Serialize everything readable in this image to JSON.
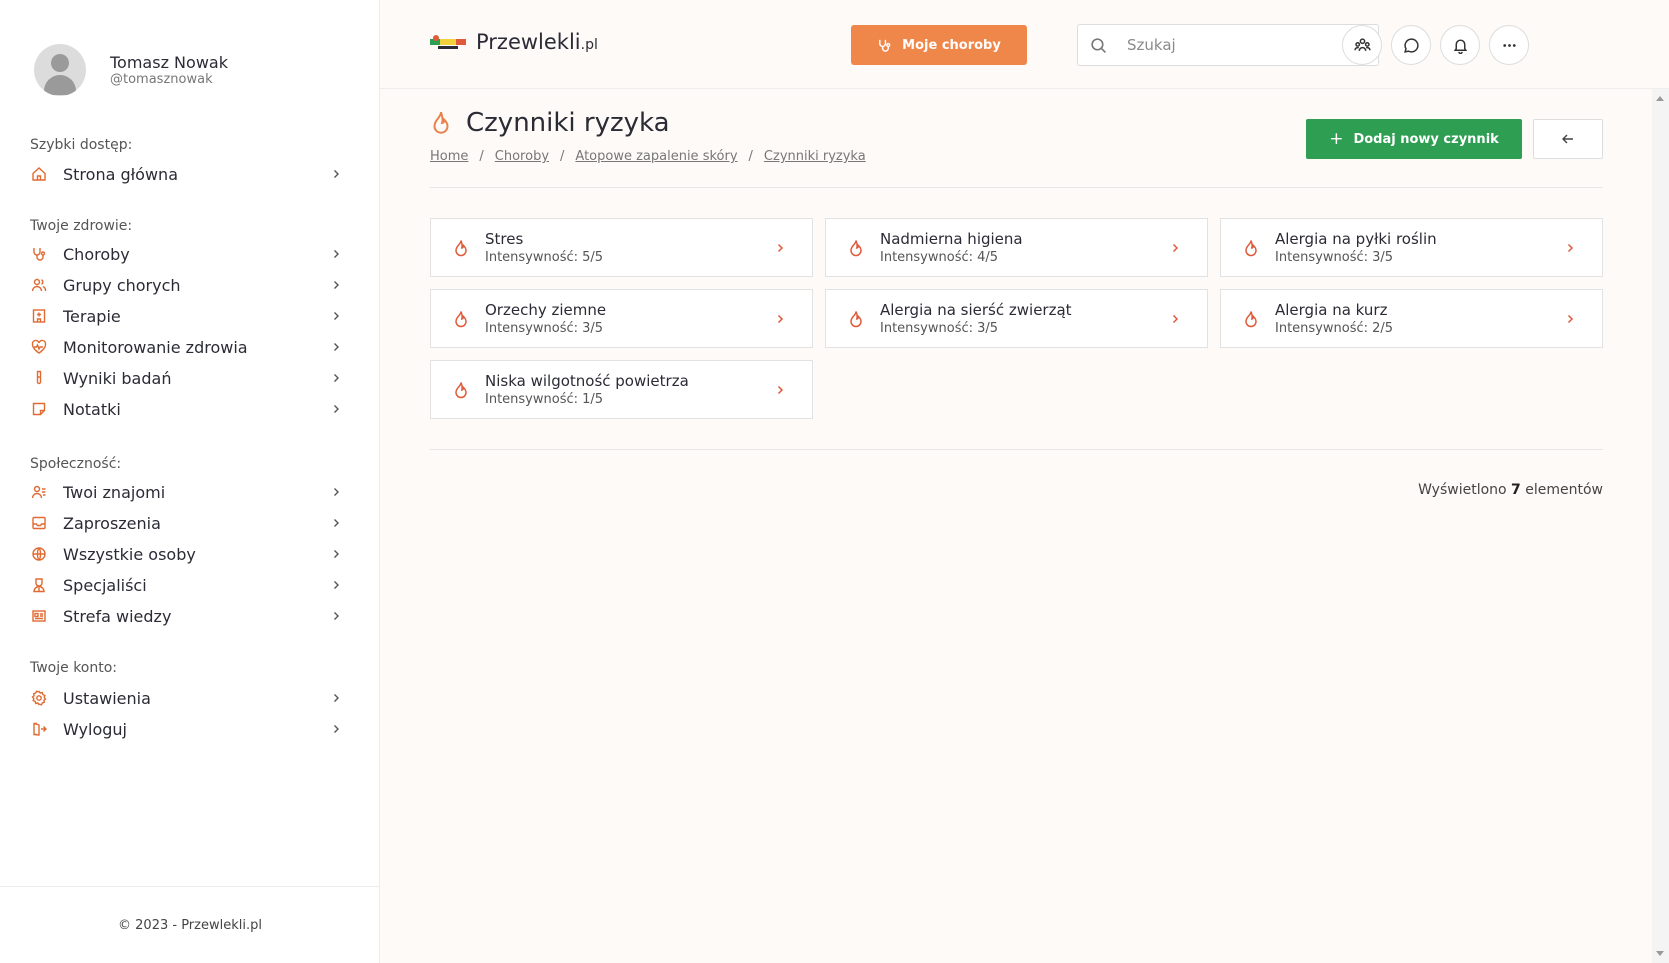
{
  "user": {
    "name": "Tomasz Nowak",
    "handle": "@tomasznowak"
  },
  "sidebar": {
    "sections": [
      {
        "title": "Szybki dostęp:",
        "items": [
          {
            "label": "Strona główna",
            "icon": "home-icon"
          }
        ]
      },
      {
        "title": "Twoje zdrowie:",
        "items": [
          {
            "label": "Choroby",
            "icon": "stethoscope-icon"
          },
          {
            "label": "Grupy chorych",
            "icon": "users-icon"
          },
          {
            "label": "Terapie",
            "icon": "hospital-icon"
          },
          {
            "label": "Monitorowanie zdrowia",
            "icon": "heart-pulse-icon"
          },
          {
            "label": "Wyniki badań",
            "icon": "test-tube-icon"
          },
          {
            "label": "Notatki",
            "icon": "note-icon"
          }
        ]
      },
      {
        "title": "Społeczność:",
        "items": [
          {
            "label": "Twoi znajomi",
            "icon": "user-list-icon"
          },
          {
            "label": "Zaproszenia",
            "icon": "inbox-icon"
          },
          {
            "label": "Wszystkie osoby",
            "icon": "globe-icon"
          },
          {
            "label": "Specjaliści",
            "icon": "doctor-icon"
          },
          {
            "label": "Strefa wiedzy",
            "icon": "newspaper-icon"
          }
        ]
      },
      {
        "title": "Twoje konto:",
        "items": [
          {
            "label": "Ustawienia",
            "icon": "gear-icon"
          },
          {
            "label": "Wyloguj",
            "icon": "logout-icon"
          }
        ]
      }
    ],
    "footer": "© 2023 - Przewlekli.pl"
  },
  "header": {
    "logo_main": "Przewlekli",
    "logo_suffix": ".pl",
    "my_diseases_button": "Moje choroby",
    "search_placeholder": "Szukaj"
  },
  "page": {
    "title": "Czynniki ryzyka",
    "breadcrumb": [
      "Home",
      "Choroby",
      "Atopowe zapalenie skóry",
      "Czynniki ryzyka"
    ],
    "add_button": "Dodaj nowy czynnik",
    "count_prefix": "Wyświetlono",
    "count_value": "7",
    "count_suffix": "elementów"
  },
  "risk_factors": [
    {
      "name": "Stres",
      "intensity": "Intensywność: 5/5"
    },
    {
      "name": "Nadmierna higiena",
      "intensity": "Intensywność: 4/5"
    },
    {
      "name": "Alergia na pyłki roślin",
      "intensity": "Intensywność: 3/5"
    },
    {
      "name": "Orzechy ziemne",
      "intensity": "Intensywność: 3/5"
    },
    {
      "name": "Alergia na sierść zwierząt",
      "intensity": "Intensywność: 3/5"
    },
    {
      "name": "Alergia na kurz",
      "intensity": "Intensywność: 2/5"
    },
    {
      "name": "Niska wilgotność powietrza",
      "intensity": "Intensywność: 1/5"
    }
  ],
  "colors": {
    "accent": "#f0874a",
    "green": "#2e9e53",
    "icon": "#e06a32"
  }
}
